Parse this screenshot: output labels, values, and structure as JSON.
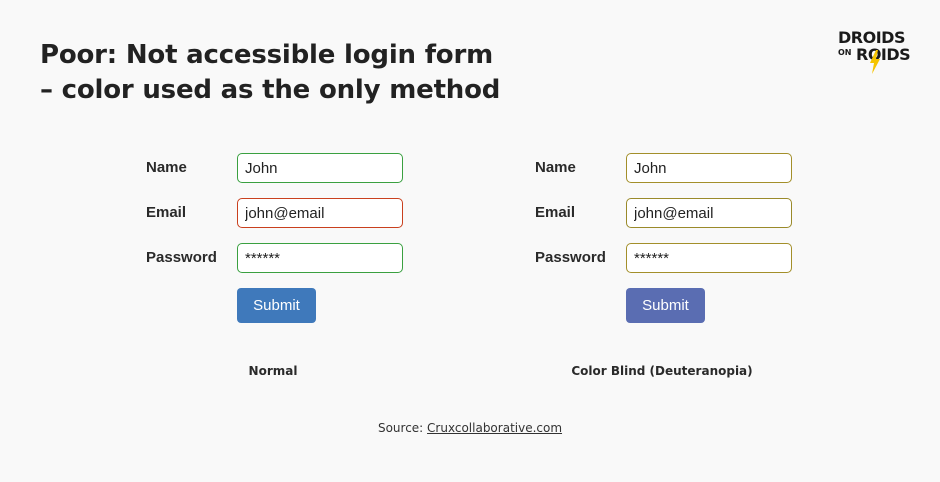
{
  "header": {
    "title_line1": "Poor: Not accessible login form",
    "title_line2": "– color used as the only method"
  },
  "logo": {
    "line1": "DROIDS",
    "line2": "ON",
    "line3": "ROIDS",
    "accent_color": "#f5c400"
  },
  "forms": [
    {
      "caption": "Normal",
      "fields": [
        {
          "label": "Name",
          "value": "John",
          "border_color": "#3aa040"
        },
        {
          "label": "Email",
          "value": "john@email",
          "border_color": "#c9401e"
        },
        {
          "label": "Password",
          "value": "******",
          "border_color": "#3aa040"
        }
      ],
      "submit_label": "Submit",
      "submit_color": "#3f79bb"
    },
    {
      "caption": "Color Blind (Deuteranopia)",
      "fields": [
        {
          "label": "Name",
          "value": "John",
          "border_color": "#a38f2a"
        },
        {
          "label": "Email",
          "value": "john@email",
          "border_color": "#9a8a2a"
        },
        {
          "label": "Password",
          "value": "******",
          "border_color": "#a38f2a"
        }
      ],
      "submit_label": "Submit",
      "submit_color": "#5a6db2"
    }
  ],
  "source": {
    "prefix": "Source: ",
    "link_text": "Cruxcollaborative.com"
  }
}
